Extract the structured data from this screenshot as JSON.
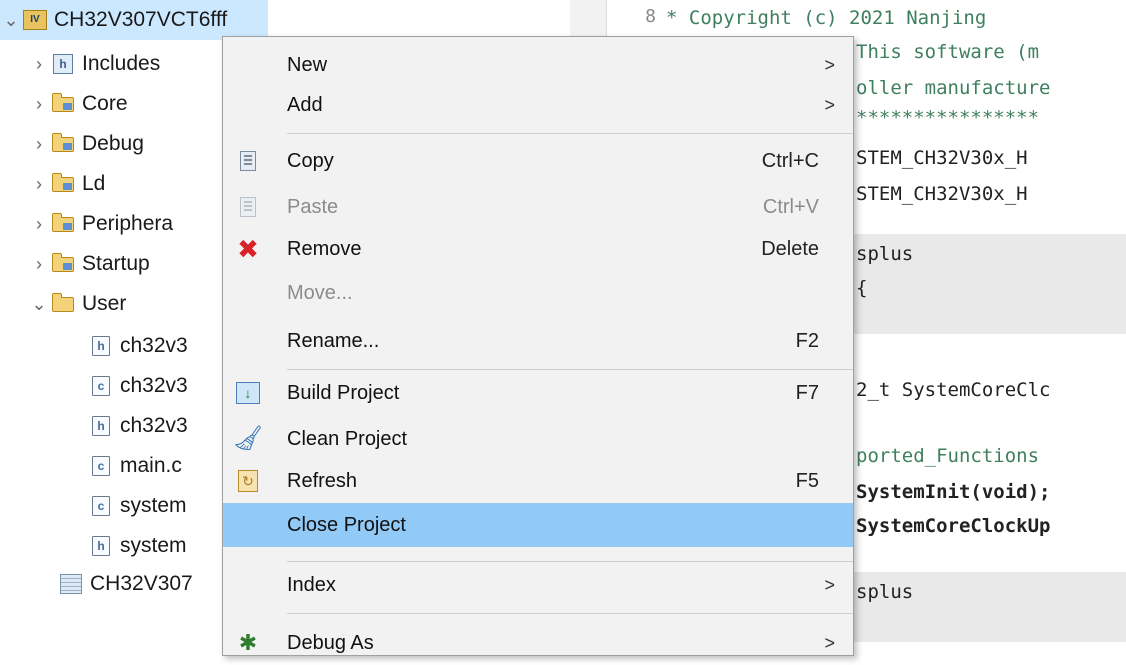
{
  "tree": {
    "project": "CH32V307VCT6fff",
    "items": [
      {
        "label": "Includes",
        "type": "includes"
      },
      {
        "label": "Core",
        "type": "folder"
      },
      {
        "label": "Debug",
        "type": "folder"
      },
      {
        "label": "Ld",
        "type": "folder"
      },
      {
        "label": "Periphera",
        "type": "folder"
      },
      {
        "label": "Startup",
        "type": "folder"
      },
      {
        "label": "User",
        "type": "folder-open"
      },
      {
        "label": "ch32v3",
        "type": "h"
      },
      {
        "label": "ch32v3",
        "type": "c"
      },
      {
        "label": "ch32v3",
        "type": "h"
      },
      {
        "label": "main.c",
        "type": "c"
      },
      {
        "label": "system",
        "type": "c"
      },
      {
        "label": "system",
        "type": "h"
      },
      {
        "label": "CH32V307",
        "type": "file"
      }
    ]
  },
  "editor": {
    "line_number": "8",
    "lines": [
      "* Copyright (c) 2021 Nanjing",
      "This software (m",
      "oller manufacture",
      "****************",
      "STEM_CH32V30x_H",
      "STEM_CH32V30x_H",
      "splus",
      "{",
      "2_t SystemCoreClc",
      "ported_Functions",
      "SystemInit(void);",
      "SystemCoreClockUp",
      "splus"
    ]
  },
  "menu": {
    "items": [
      {
        "label": "New",
        "submenu": true
      },
      {
        "label": "Add",
        "submenu": true
      },
      {
        "label": "Copy",
        "shortcut": "Ctrl+C",
        "icon": "copy-icon"
      },
      {
        "label": "Paste",
        "shortcut": "Ctrl+V",
        "icon": "paste-icon",
        "disabled": true
      },
      {
        "label": "Remove",
        "shortcut": "Delete",
        "icon": "remove-icon"
      },
      {
        "label": "Move...",
        "disabled": true
      },
      {
        "label": "Rename...",
        "shortcut": "F2"
      },
      {
        "label": "Build Project",
        "shortcut": "F7",
        "icon": "build-icon"
      },
      {
        "label": "Clean Project",
        "icon": "clean-icon"
      },
      {
        "label": "Refresh",
        "shortcut": "F5",
        "icon": "refresh-icon"
      },
      {
        "label": "Close Project",
        "highlighted": true
      },
      {
        "label": "Index",
        "submenu": true
      },
      {
        "label": "Debug As",
        "submenu": true,
        "icon": "debug-icon"
      }
    ],
    "arrow_glyph": ">"
  },
  "colors": {
    "highlight": "#91c9f7",
    "selection": "#cce8ff",
    "remove_icon": "#d8232a"
  }
}
